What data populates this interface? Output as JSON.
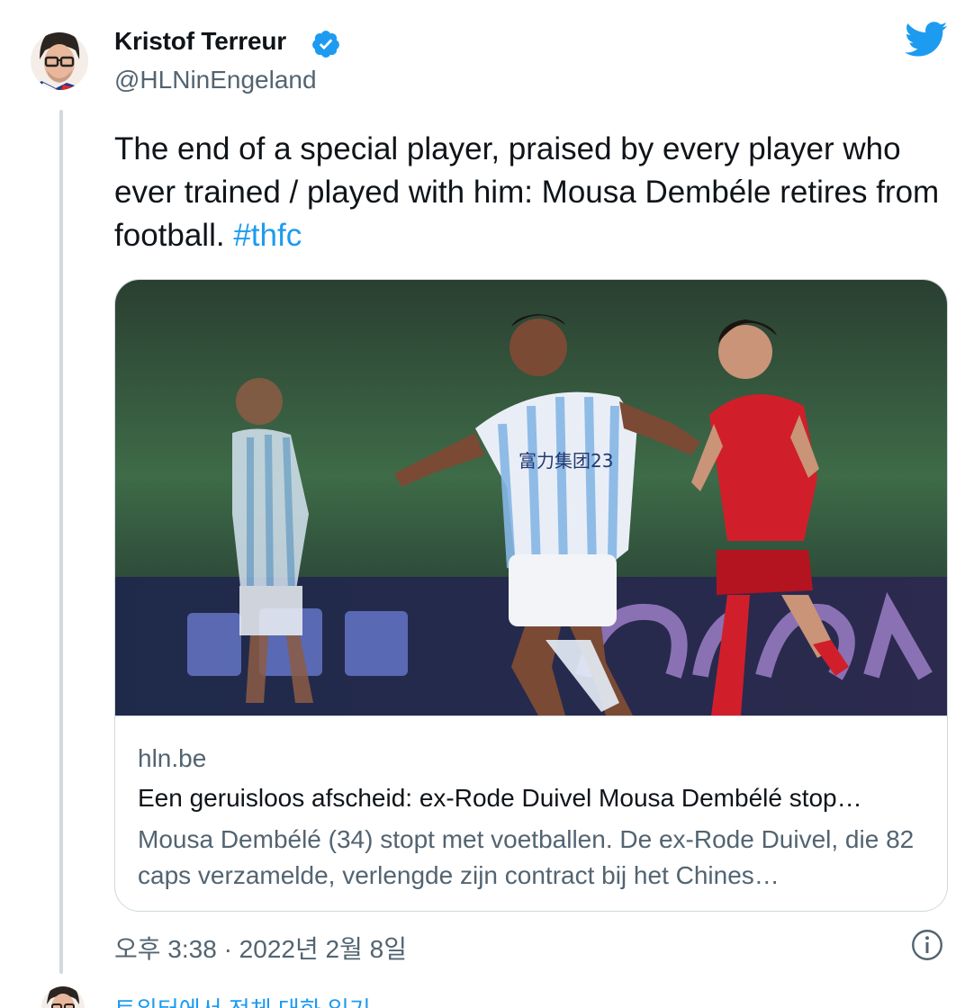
{
  "author": {
    "name": "Kristof Terreur",
    "handle": "@HLNinEngeland",
    "verified": true
  },
  "tweet": {
    "text": "The end of a special player, praised by every player who ever trained / played with him: Mousa Dembéle retires from football. ",
    "hashtag": "#thfc"
  },
  "card": {
    "domain": "hln.be",
    "title": "Een geruisloos afscheid: ex-Rode Duivel Mousa Dembélé stop…",
    "description": "Mousa Dembélé (34) stopt met voetballen. De ex-Rode Duivel, die 82 caps verzamelde, verlengde zijn contract bij het Chines…"
  },
  "footer": {
    "timestamp": "오후 3:38 · 2022년 2월 8일",
    "read_more": "트위터에서 전체 대화 읽기"
  },
  "icons": {
    "brand": "twitter-bird-icon",
    "verified": "verified-badge-icon",
    "info": "info-icon"
  },
  "colors": {
    "accent": "#1d9bf0",
    "text": "#0f1419",
    "secondary": "#536471",
    "border": "#cfd9de"
  }
}
